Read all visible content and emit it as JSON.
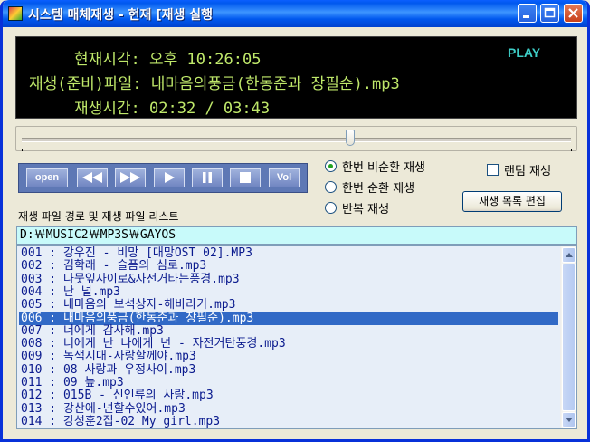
{
  "window": {
    "title": "시스템 매체재생 - 현재 [재생 실행"
  },
  "display": {
    "clock": "현재시각: 오후 10:26:05",
    "file": "재생(준비)파일: 내마음의풍금(한동준과 장필순).mp3",
    "time": "재생시간: 02:32 / 03:43",
    "state": "PLAY"
  },
  "seek": {
    "position_fraction": 0.6
  },
  "controls": {
    "open_label": "open",
    "vol_label": "Vol"
  },
  "modes": [
    {
      "label": "한번 비순환 재생",
      "selected": true
    },
    {
      "label": "한번 순환 재생",
      "selected": false
    },
    {
      "label": "반복 재생",
      "selected": false
    }
  ],
  "random": {
    "label": "랜덤 재생",
    "checked": false
  },
  "edit_playlist_label": "재생 목록 편집",
  "list_label": "재생 파일 경로 및 재생 파일 리스트",
  "path": "D:￦MUSIC2￦MP3S￦GAYOS",
  "playlist": [
    "001 :  강우진 - 비망 [대망OST 02].MP3",
    "002 :  김학래 - 슬픔의 심로.mp3",
    "003 :  나뭇잎사이로&자전거타는풍경.mp3",
    "004 :  난 널.mp3",
    "005 :  내마음의 보석상자-해바라기.mp3",
    "006 :  내마음의풍금(한동준과 장필순).mp3",
    "007 :  너에게 감사해.mp3",
    "008 :  너에게 난 나에게 넌 - 자전거탄풍경.mp3",
    "009 :  녹색지대-사랑할께야.mp3",
    "010 :  08 사랑과 우정사이.mp3",
    "011 :  09 늪.mp3",
    "012 :  015B - 신인류의 사랑.mp3",
    "013 :  강산에-넌할수있어.mp3",
    "014 :  강성훈2집-02 My girl.mp3"
  ],
  "selected_index": 5
}
